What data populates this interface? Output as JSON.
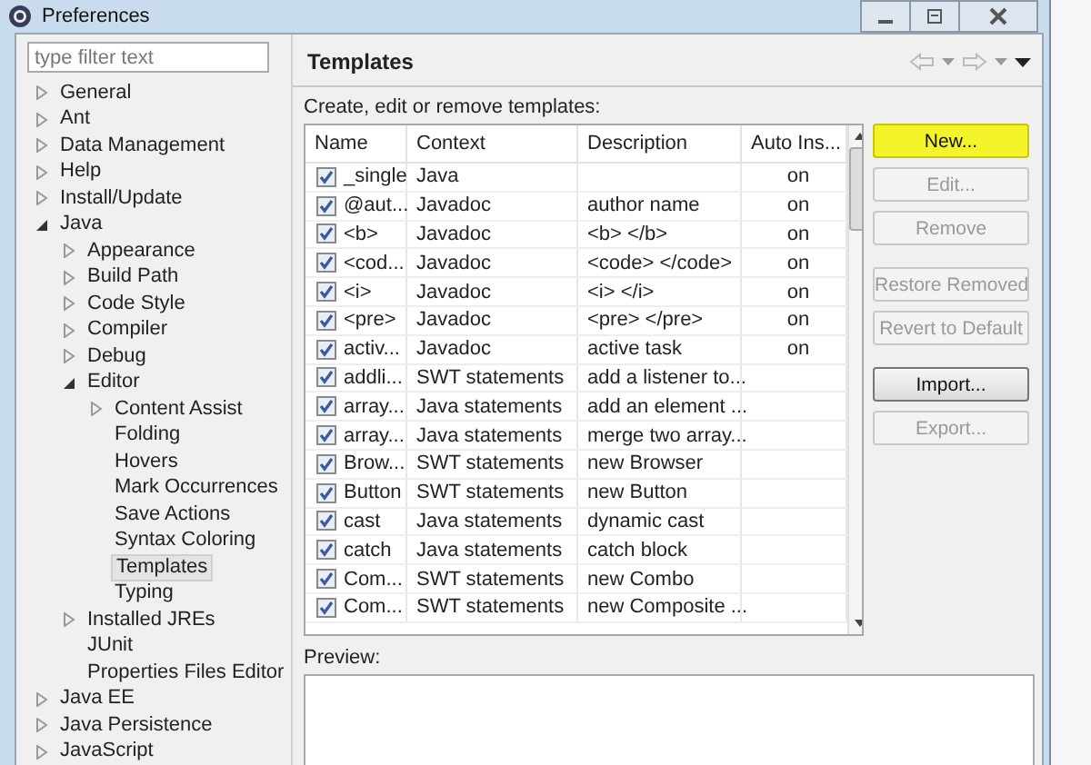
{
  "window": {
    "title": "Preferences"
  },
  "filter": {
    "placeholder": "type filter text"
  },
  "tree": [
    {
      "label": "General",
      "expanded": false,
      "selected": false
    },
    {
      "label": "Ant",
      "expanded": false,
      "selected": false
    },
    {
      "label": "Data Management",
      "expanded": false,
      "selected": false
    },
    {
      "label": "Help",
      "expanded": false,
      "selected": false
    },
    {
      "label": "Install/Update",
      "expanded": false,
      "selected": false
    },
    {
      "label": "Java",
      "expanded": true,
      "selected": false,
      "children": [
        {
          "label": "Appearance",
          "expanded": false,
          "selected": false
        },
        {
          "label": "Build Path",
          "expanded": false,
          "selected": false
        },
        {
          "label": "Code Style",
          "expanded": false,
          "selected": false
        },
        {
          "label": "Compiler",
          "expanded": false,
          "selected": false
        },
        {
          "label": "Debug",
          "expanded": false,
          "selected": false
        },
        {
          "label": "Editor",
          "expanded": true,
          "selected": false,
          "children": [
            {
              "label": "Content Assist",
              "expanded": false,
              "selected": false
            },
            {
              "label": "Folding",
              "selected": false
            },
            {
              "label": "Hovers",
              "selected": false
            },
            {
              "label": "Mark Occurrences",
              "selected": false
            },
            {
              "label": "Save Actions",
              "selected": false
            },
            {
              "label": "Syntax Coloring",
              "selected": false
            },
            {
              "label": "Templates",
              "selected": true
            },
            {
              "label": "Typing",
              "selected": false
            }
          ]
        },
        {
          "label": "Installed JREs",
          "expanded": false,
          "selected": false
        },
        {
          "label": "JUnit",
          "selected": false
        },
        {
          "label": "Properties Files Editor",
          "selected": false
        }
      ]
    },
    {
      "label": "Java EE",
      "expanded": false,
      "selected": false
    },
    {
      "label": "Java Persistence",
      "expanded": false,
      "selected": false
    },
    {
      "label": "JavaScript",
      "expanded": false,
      "selected": false
    }
  ],
  "page": {
    "title": "Templates",
    "description": "Create, edit or remove templates:"
  },
  "table": {
    "columns": [
      "Name",
      "Context",
      "Description",
      "Auto Ins..."
    ],
    "rows": [
      {
        "checked": true,
        "cells": [
          "_single",
          "Java",
          "",
          "on"
        ]
      },
      {
        "checked": true,
        "cells": [
          "@aut...",
          "Javadoc",
          "author name",
          "on"
        ]
      },
      {
        "checked": true,
        "cells": [
          "<b>",
          "Javadoc",
          "<b> </b>",
          "on"
        ]
      },
      {
        "checked": true,
        "cells": [
          "<cod...",
          "Javadoc",
          "<code> </code>",
          "on"
        ]
      },
      {
        "checked": true,
        "cells": [
          "<i>",
          "Javadoc",
          "<i> </i>",
          "on"
        ]
      },
      {
        "checked": true,
        "cells": [
          "<pre>",
          "Javadoc",
          "<pre> </pre>",
          "on"
        ]
      },
      {
        "checked": true,
        "cells": [
          "activ...",
          "Javadoc",
          "active task",
          "on"
        ]
      },
      {
        "checked": true,
        "cells": [
          "addli...",
          "SWT statements",
          "add a listener to...",
          ""
        ]
      },
      {
        "checked": true,
        "cells": [
          "array...",
          "Java statements",
          "add an element ...",
          ""
        ]
      },
      {
        "checked": true,
        "cells": [
          "array...",
          "Java statements",
          "merge two array...",
          ""
        ]
      },
      {
        "checked": true,
        "cells": [
          "Brow...",
          "SWT statements",
          "new Browser",
          ""
        ]
      },
      {
        "checked": true,
        "cells": [
          "Button",
          "SWT statements",
          "new Button",
          ""
        ]
      },
      {
        "checked": true,
        "cells": [
          "cast",
          "Java statements",
          "dynamic cast",
          ""
        ]
      },
      {
        "checked": true,
        "cells": [
          "catch",
          "Java statements",
          "catch block",
          ""
        ]
      },
      {
        "checked": true,
        "cells": [
          "Com...",
          "SWT statements",
          "new Combo",
          ""
        ]
      },
      {
        "checked": true,
        "cells": [
          "Com...",
          "SWT statements",
          "new Composite ...",
          ""
        ]
      }
    ]
  },
  "button_groups": [
    [
      {
        "label": "New...",
        "disabled": false,
        "highlighted": true
      },
      {
        "label": "Edit...",
        "disabled": true,
        "highlighted": false
      },
      {
        "label": "Remove",
        "disabled": true,
        "highlighted": false
      }
    ],
    [
      {
        "label": "Restore Removed",
        "disabled": true,
        "highlighted": false
      },
      {
        "label": "Revert to Default",
        "disabled": true,
        "highlighted": false
      }
    ],
    [
      {
        "label": "Import...",
        "disabled": false,
        "highlighted": false
      },
      {
        "label": "Export...",
        "disabled": true,
        "highlighted": false
      }
    ]
  ],
  "preview": {
    "label": "Preview:"
  }
}
